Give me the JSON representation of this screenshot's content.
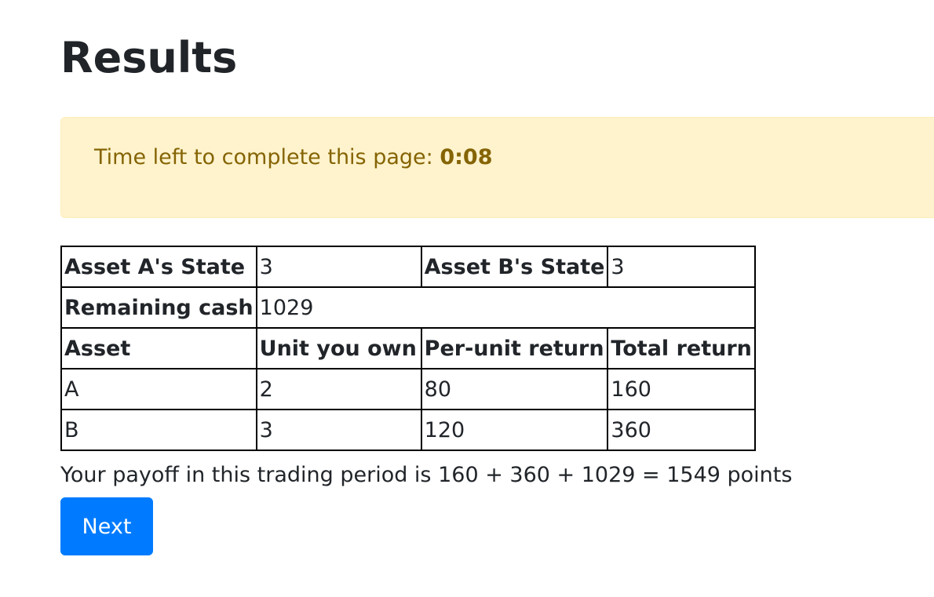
{
  "page": {
    "title": "Results"
  },
  "timer": {
    "label": "Time left to complete this page: ",
    "time": "0:08"
  },
  "table": {
    "state_row": {
      "asset_a_label": "Asset A's State",
      "asset_a_value": "3",
      "asset_b_label": "Asset B's State",
      "asset_b_value": "3"
    },
    "cash_row": {
      "label": "Remaining cash",
      "value": "1029"
    },
    "headers": [
      "Asset",
      "Unit you own",
      "Per-unit return",
      "Total return"
    ],
    "rows": [
      [
        "A",
        "2",
        "80",
        "160"
      ],
      [
        "B",
        "3",
        "120",
        "360"
      ]
    ]
  },
  "payoff": {
    "text": "Your payoff in this trading period is 160 + 360 + 1029 = 1549 points"
  },
  "buttons": {
    "next_label": "Next"
  },
  "colors": {
    "alert_bg": "#fff3cd",
    "alert_text": "#856404",
    "button_bg": "#007bff"
  }
}
